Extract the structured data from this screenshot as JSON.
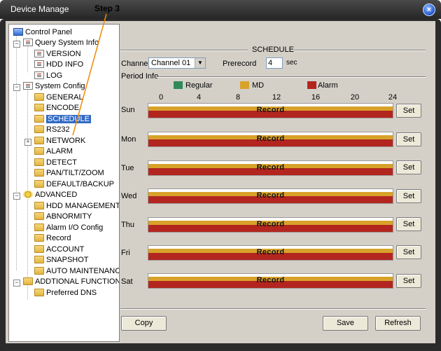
{
  "annotation": {
    "label": "Step 3"
  },
  "window": {
    "title": "Device Manage",
    "close": "×"
  },
  "tree": {
    "items": [
      {
        "label": "Control Panel"
      },
      {
        "label": "Query System Info"
      },
      {
        "label": "VERSION"
      },
      {
        "label": "HDD INFO"
      },
      {
        "label": "LOG"
      },
      {
        "label": "System Config"
      },
      {
        "label": "GENERAL"
      },
      {
        "label": "ENCODE"
      },
      {
        "label": "SCHEDULE"
      },
      {
        "label": "RS232"
      },
      {
        "label": "NETWORK"
      },
      {
        "label": "ALARM"
      },
      {
        "label": "DETECT"
      },
      {
        "label": "PAN/TILT/ZOOM"
      },
      {
        "label": "DEFAULT/BACKUP"
      },
      {
        "label": "ADVANCED"
      },
      {
        "label": "HDD MANAGEMENT"
      },
      {
        "label": "ABNORMITY"
      },
      {
        "label": "Alarm I/O Config"
      },
      {
        "label": "Record"
      },
      {
        "label": "ACCOUNT"
      },
      {
        "label": "SNAPSHOT"
      },
      {
        "label": "AUTO MAINTENANCE"
      },
      {
        "label": "ADDTIONAL FUNCTION"
      },
      {
        "label": "Preferred DNS"
      }
    ]
  },
  "schedule": {
    "section_title": "SCHEDULE",
    "channel_label": "Channel",
    "channel_value": "Channel 01",
    "prerecord_label": "Prerecord",
    "prerecord_value": "4",
    "prerecord_unit": "sec",
    "period_label": "Period Info",
    "legend": [
      {
        "label": "Regular",
        "color": "#2e8b57"
      },
      {
        "label": "MD",
        "color": "#d8a22a"
      },
      {
        "label": "Alarm",
        "color": "#b2261f"
      }
    ],
    "hours": [
      "0",
      "4",
      "8",
      "12",
      "16",
      "20",
      "24"
    ],
    "days": [
      {
        "name": "Sun",
        "bar_label": "Record",
        "set": "Set"
      },
      {
        "name": "Mon",
        "bar_label": "Record",
        "set": "Set"
      },
      {
        "name": "Tue",
        "bar_label": "Record",
        "set": "Set"
      },
      {
        "name": "Wed",
        "bar_label": "Record",
        "set": "Set"
      },
      {
        "name": "Thu",
        "bar_label": "Record",
        "set": "Set"
      },
      {
        "name": "Fri",
        "bar_label": "Record",
        "set": "Set"
      },
      {
        "name": "Sat",
        "bar_label": "Record",
        "set": "Set"
      }
    ],
    "buttons": {
      "copy": "Copy",
      "save": "Save",
      "refresh": "Refresh"
    }
  }
}
